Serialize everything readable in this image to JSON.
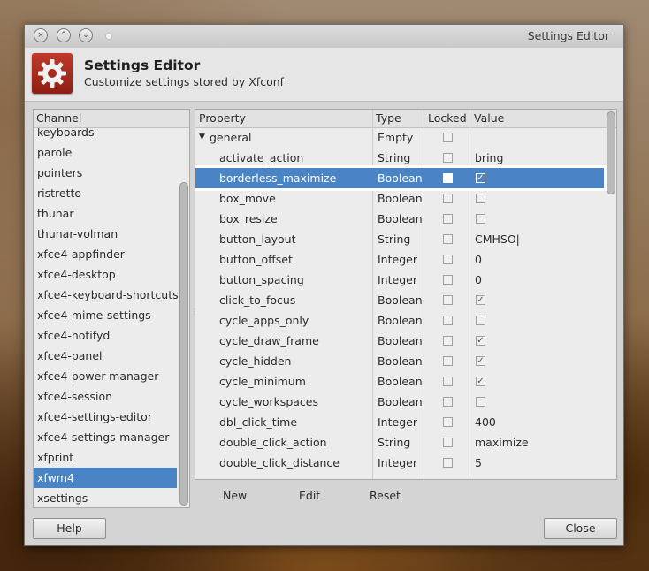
{
  "window": {
    "title": "Settings Editor"
  },
  "header": {
    "title": "Settings Editor",
    "subtitle": "Customize settings stored by Xfconf",
    "icon": "gear-icon"
  },
  "titlebar_buttons": {
    "close": "×",
    "minimize": "⌃",
    "maximize": "⌄"
  },
  "channels": {
    "header": "Channel",
    "items": [
      "keyboards",
      "parole",
      "pointers",
      "ristretto",
      "thunar",
      "thunar-volman",
      "xfce4-appfinder",
      "xfce4-desktop",
      "xfce4-keyboard-shortcuts",
      "xfce4-mime-settings",
      "xfce4-notifyd",
      "xfce4-panel",
      "xfce4-power-manager",
      "xfce4-session",
      "xfce4-settings-editor",
      "xfce4-settings-manager",
      "xfprint",
      "xfwm4",
      "xsettings"
    ],
    "selected": "xfwm4"
  },
  "properties": {
    "headers": {
      "property": "Property",
      "type": "Type",
      "locked": "Locked",
      "value": "Value"
    },
    "group": {
      "name": "general",
      "type": "Empty"
    },
    "rows": [
      {
        "name": "activate_action",
        "type": "String",
        "value": "bring"
      },
      {
        "name": "borderless_maximize",
        "type": "Boolean",
        "value": "true",
        "selected": true
      },
      {
        "name": "box_move",
        "type": "Boolean",
        "value": "false"
      },
      {
        "name": "box_resize",
        "type": "Boolean",
        "value": "false"
      },
      {
        "name": "button_layout",
        "type": "String",
        "value": "CMHSO|"
      },
      {
        "name": "button_offset",
        "type": "Integer",
        "value": "0"
      },
      {
        "name": "button_spacing",
        "type": "Integer",
        "value": "0"
      },
      {
        "name": "click_to_focus",
        "type": "Boolean",
        "value": "true"
      },
      {
        "name": "cycle_apps_only",
        "type": "Boolean",
        "value": "false"
      },
      {
        "name": "cycle_draw_frame",
        "type": "Boolean",
        "value": "true"
      },
      {
        "name": "cycle_hidden",
        "type": "Boolean",
        "value": "true"
      },
      {
        "name": "cycle_minimum",
        "type": "Boolean",
        "value": "true"
      },
      {
        "name": "cycle_workspaces",
        "type": "Boolean",
        "value": "false"
      },
      {
        "name": "dbl_click_time",
        "type": "Integer",
        "value": "400"
      },
      {
        "name": "double_click_action",
        "type": "String",
        "value": "maximize"
      },
      {
        "name": "double_click_distance",
        "type": "Integer",
        "value": "5"
      }
    ]
  },
  "actions": {
    "new": "New",
    "edit": "Edit",
    "reset": "Reset"
  },
  "buttons": {
    "help": "Help",
    "close": "Close"
  },
  "colors": {
    "selection": "#4a84c4",
    "accent": "#c0392b"
  }
}
